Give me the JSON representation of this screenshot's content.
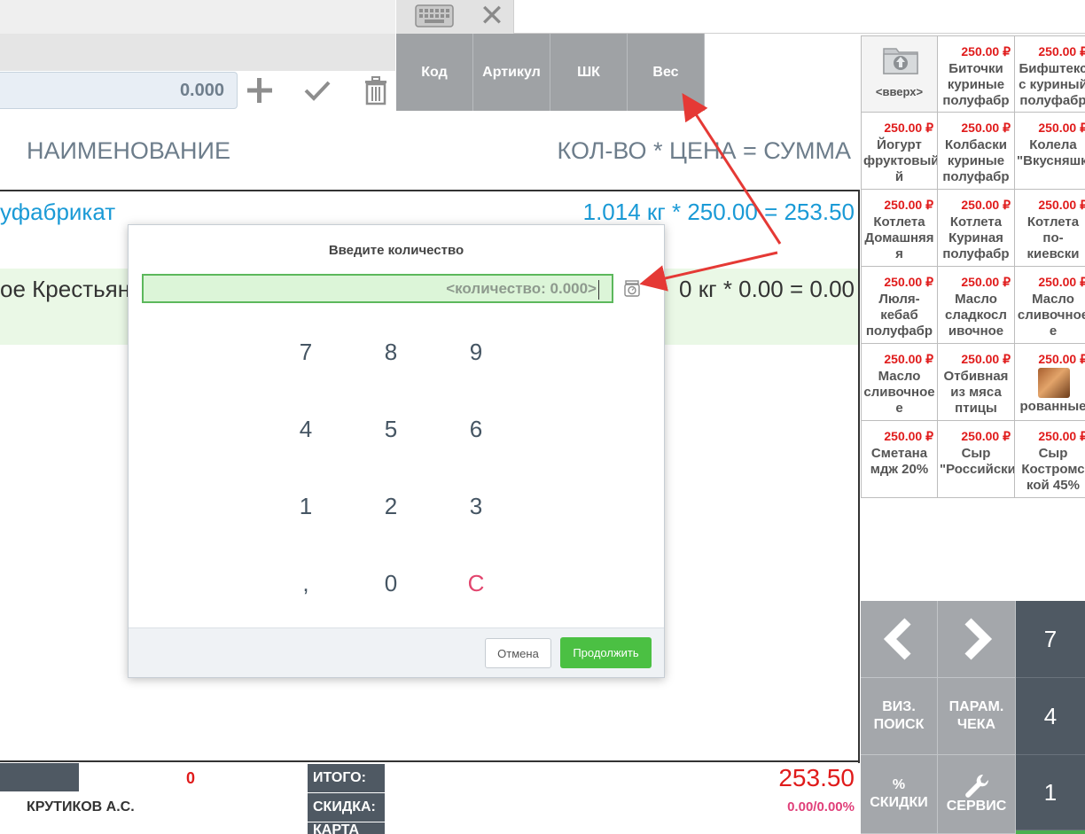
{
  "search_modes": [
    "Код",
    "Артикул",
    "ШК",
    "Вес"
  ],
  "quantity_field": {
    "value": "0.000"
  },
  "headers": {
    "name": "НАИМЕНОВАНИЕ",
    "qty_price_sum": "КОЛ-ВО * ЦЕНА = СУММА"
  },
  "receipt_lines": [
    {
      "name": "уфабрикат",
      "calc": "1.014 кг * 250.00 = 253.50"
    },
    {
      "name": "ое Крестьян",
      "calc": "0 кг * 0.00 = 0.00"
    }
  ],
  "products": [
    {
      "price": "",
      "name": "<вверх>"
    },
    {
      "price": "250.00 ₽",
      "name": "Биточки куриные полуфабр"
    },
    {
      "price": "250.00 ₽",
      "name": "Бифштекс с куриный полуфабр"
    },
    {
      "price": "250.00 ₽",
      "name": "Йогурт фруктовый й"
    },
    {
      "price": "250.00 ₽",
      "name": "Колбаски куриные полуфабр"
    },
    {
      "price": "250.00 ₽",
      "name": "Колела \"Вкусняшка\""
    },
    {
      "price": "250.00 ₽",
      "name": "Котлета Домашняя я"
    },
    {
      "price": "250.00 ₽",
      "name": "Котлета Куриная полуфабр"
    },
    {
      "price": "250.00 ₽",
      "name": "Котлета по-киевски"
    },
    {
      "price": "250.00 ₽",
      "name": "Люля-кебаб полуфабр"
    },
    {
      "price": "250.00 ₽",
      "name": "Масло сладкосл ивочное"
    },
    {
      "price": "250.00 ₽",
      "name": "Масло сливочное е"
    },
    {
      "price": "250.00 ₽",
      "name": "Масло сливочное е"
    },
    {
      "price": "250.00 ₽",
      "name": "Отбивная из мяса птицы"
    },
    {
      "price": "250.00 ₽",
      "name": "рованные"
    },
    {
      "price": "250.00 ₽",
      "name": "Сметана мдж 20%"
    },
    {
      "price": "250.00 ₽",
      "name": "Сыр \"Российский"
    },
    {
      "price": "250.00 ₽",
      "name": "Сыр Костромс кой 45%"
    }
  ],
  "controls": {
    "viz_search": "ВИЗ. ПОИСК",
    "check_params": "ПАРАМ. ЧЕКА",
    "discounts_pct": "%",
    "discounts": "СКИДКИ",
    "service": "СЕРВИС",
    "num7": "7",
    "num4": "4",
    "num1": "1"
  },
  "totals": {
    "zero": "0",
    "cashier": "КРУТИКОВ А.С.",
    "total_label": "ИТОГО:",
    "total_value": "253.50",
    "discount_label": "СКИДКА:",
    "discount_value": "0.00/0.00%",
    "card_label": "КАРТА"
  },
  "dialog": {
    "title": "Введите количество",
    "placeholder": "<количество: 0.000>",
    "keys": [
      "7",
      "8",
      "9",
      "4",
      "5",
      "6",
      "1",
      "2",
      "3",
      ",",
      "0",
      "C"
    ],
    "cancel": "Отмена",
    "continue": "Продолжить"
  },
  "colors": {
    "accent_red": "#e01b1b",
    "accent_blue": "#1a9ad6",
    "primary_green": "#4bc043",
    "dark_tile": "#4f5963",
    "grey_tile": "#a4a7ab"
  }
}
